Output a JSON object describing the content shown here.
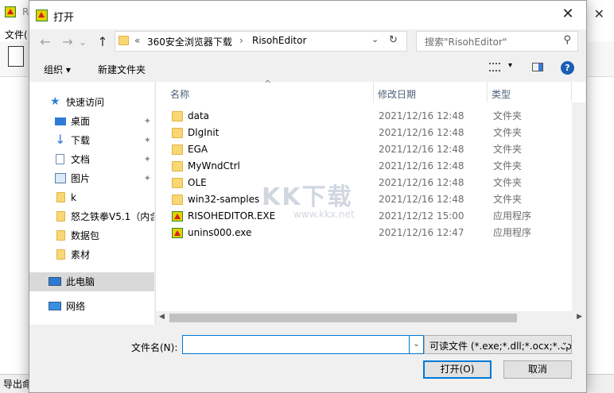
{
  "background_app": {
    "title_fragment": "R",
    "menu_fragment": "文件(",
    "status_fragment": "导出命"
  },
  "dialog": {
    "title": "打开",
    "close_glyph": "✕"
  },
  "navbar": {
    "back_glyph": "←",
    "forward_glyph": "→",
    "dropdown_glyph": "⌄",
    "up_glyph": "↑",
    "breadcrumb_prefix": "«",
    "breadcrumb": [
      "360安全浏览器下载",
      "RisohEditor"
    ],
    "breadcrumb_sep": "›",
    "refresh_glyph": "↻",
    "search_placeholder": "搜索\"RisohEditor\"",
    "search_glyph": "⚲"
  },
  "commandbar": {
    "organize": "组织 ▾",
    "new_folder": "新建文件夹",
    "help_glyph": "?"
  },
  "sidebar": {
    "items": [
      {
        "label": "快速访问",
        "icon": "star-icon"
      },
      {
        "label": "桌面",
        "icon": "desktop-icon",
        "pinned": true
      },
      {
        "label": "下载",
        "icon": "download-icon",
        "pinned": true
      },
      {
        "label": "文档",
        "icon": "document-icon",
        "pinned": true
      },
      {
        "label": "图片",
        "icon": "picture-icon",
        "pinned": true
      },
      {
        "label": "k",
        "icon": "folder-icon"
      },
      {
        "label": "怒之铁拳V5.1（内含",
        "icon": "folder-icon"
      },
      {
        "label": "数据包",
        "icon": "folder-icon"
      },
      {
        "label": "素材",
        "icon": "folder-icon"
      },
      {
        "label": "此电脑",
        "icon": "computer-icon",
        "selected": true
      },
      {
        "label": "网络",
        "icon": "network-icon"
      }
    ],
    "pin_glyph": "📌"
  },
  "file_list": {
    "columns": [
      "名称",
      "修改日期",
      "类型"
    ],
    "sort_glyph": "^",
    "rows": [
      {
        "name": "data",
        "date": "2021/12/16 12:48",
        "type": "文件夹",
        "icon": "folder-icon"
      },
      {
        "name": "DlgInit",
        "date": "2021/12/16 12:48",
        "type": "文件夹",
        "icon": "folder-icon"
      },
      {
        "name": "EGA",
        "date": "2021/12/16 12:48",
        "type": "文件夹",
        "icon": "folder-icon"
      },
      {
        "name": "MyWndCtrl",
        "date": "2021/12/16 12:48",
        "type": "文件夹",
        "icon": "folder-icon"
      },
      {
        "name": "OLE",
        "date": "2021/12/16 12:48",
        "type": "文件夹",
        "icon": "folder-icon"
      },
      {
        "name": "win32-samples",
        "date": "2021/12/16 12:48",
        "type": "文件夹",
        "icon": "folder-icon"
      },
      {
        "name": "RISOHEDITOR.EXE",
        "date": "2021/12/12 15:00",
        "type": "应用程序",
        "icon": "app-icon"
      },
      {
        "name": "unins000.exe",
        "date": "2021/12/16 12:47",
        "type": "应用程序",
        "icon": "app-icon"
      }
    ]
  },
  "watermark": {
    "big": "KK下载",
    "small": "www.kkx.net"
  },
  "bottom": {
    "filename_label": "文件名(N):",
    "filename_value": "",
    "filetype_value": "可读文件 (*.exe;*.dll;*.ocx;*.cp",
    "open_button": "打开(O)",
    "cancel_button": "取消"
  },
  "colors": {
    "accent": "#0078d7",
    "selected_bg": "#d9d9d9",
    "header_text": "#4c607a"
  }
}
